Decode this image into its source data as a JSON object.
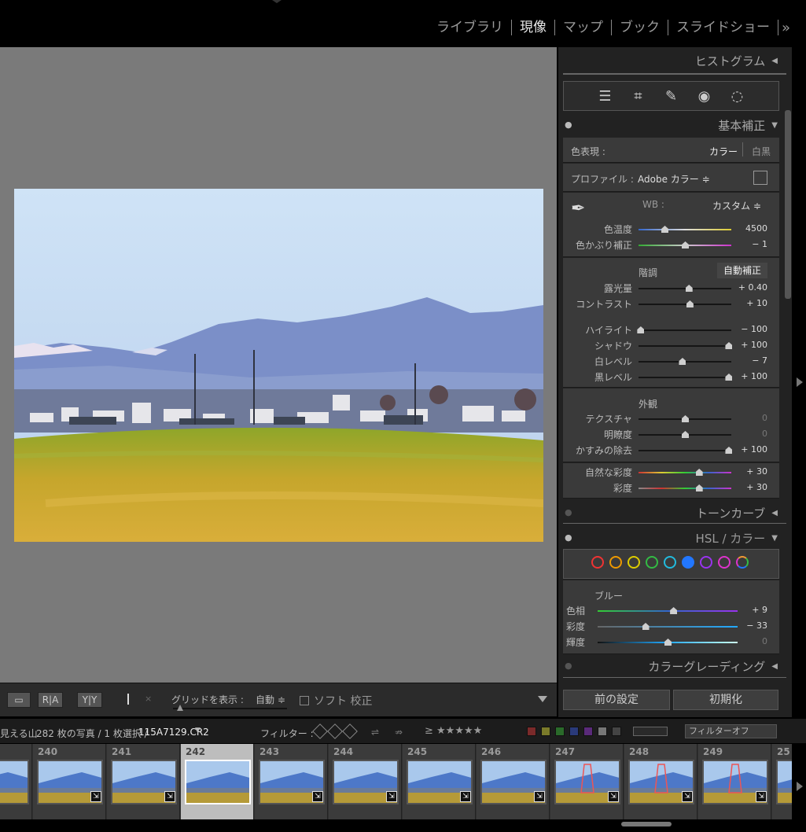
{
  "modules": [
    "ライブラリ",
    "現像",
    "マップ",
    "ブック",
    "スライドショー"
  ],
  "modules_more": "»",
  "right_panel": {
    "histogram_title": "ヒストグラム",
    "basic_title": "基本補正",
    "treatment_label": "色表現 :",
    "treatment_color": "カラー",
    "treatment_bw": "白黒",
    "profile_label": "プロファイル :",
    "profile_value": "Adobe カラー ≑",
    "wb_label": "WB :",
    "wb_value": "カスタム ≑",
    "tone_label": "階調",
    "auto_label": "自動補正",
    "presence_label": "外観",
    "sliders": [
      {
        "label": "色温度",
        "value": "4500",
        "pos": 0.28
      },
      {
        "label": "色かぶり補正",
        "value": "− 1",
        "pos": 0.5
      },
      {
        "label": "露光量",
        "value": "+ 0.40",
        "pos": 0.54
      },
      {
        "label": "コントラスト",
        "value": "+ 10",
        "pos": 0.55
      },
      {
        "label": "ハイライト",
        "value": "− 100",
        "pos": 0.02
      },
      {
        "label": "シャドウ",
        "value": "+ 100",
        "pos": 0.97
      },
      {
        "label": "白レベル",
        "value": "− 7",
        "pos": 0.47
      },
      {
        "label": "黒レベル",
        "value": "+ 100",
        "pos": 0.97
      },
      {
        "label": "テクスチャ",
        "value": "0",
        "pos": 0.5
      },
      {
        "label": "明瞭度",
        "value": "0",
        "pos": 0.5
      },
      {
        "label": "かすみの除去",
        "value": "+ 100",
        "pos": 0.97
      },
      {
        "label": "自然な彩度",
        "value": "+ 30",
        "pos": 0.65
      },
      {
        "label": "彩度",
        "value": "+ 30",
        "pos": 0.65
      }
    ],
    "tone_curve_title": "トーンカーブ",
    "hsl_title": "HSL / カラー",
    "hsl_channel": "ブルー",
    "hsl_sliders": [
      {
        "label": "色相",
        "value": "+ 9",
        "pos": 0.54
      },
      {
        "label": "彩度",
        "value": "− 33",
        "pos": 0.34
      },
      {
        "label": "輝度",
        "value": "0",
        "pos": 0.5
      }
    ],
    "hsl_colors": [
      "#e33",
      "#e90",
      "#dc0",
      "#3b4",
      "#2bd",
      "#27f",
      "#93e",
      "#d3c",
      "multi"
    ],
    "color_grading_title": "カラーグレーディング",
    "prev_button": "前の設定",
    "reset_button": "初期化"
  },
  "toolbar": {
    "view_loupe": "▭",
    "view_ra": "R|A",
    "view_yy": "Y|Y",
    "grid_label": "グリッドを表示 :",
    "grid_value": "自動 ≑",
    "soft_proof": "ソフト 校正"
  },
  "filmstrip_bar": {
    "folder": "見える山",
    "count": "282 枚の写真 / 1 枚選択 /",
    "filename": "115A7129.CR2",
    "filter_label": "フィルター :",
    "stars": "≥ ★★★★★",
    "filter_off": "フィルターオフ"
  },
  "filmstrip": [
    {
      "num": ""
    },
    {
      "num": "240"
    },
    {
      "num": "241"
    },
    {
      "num": "242",
      "selected": true
    },
    {
      "num": "243"
    },
    {
      "num": "244"
    },
    {
      "num": "245"
    },
    {
      "num": "246"
    },
    {
      "num": "247"
    },
    {
      "num": "248"
    },
    {
      "num": "249"
    },
    {
      "num": "25"
    }
  ]
}
